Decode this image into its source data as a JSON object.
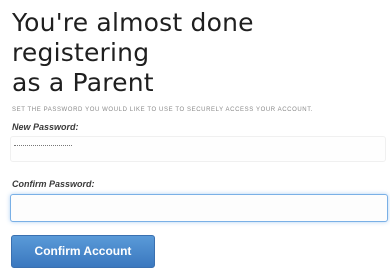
{
  "heading": {
    "line1": "You're almost done registering",
    "line2": "as a Parent",
    "subtitle": "Set the password you would like to use to securely access your account."
  },
  "form": {
    "new_password_label": "New Password:",
    "new_password_value": "••••••••",
    "confirm_password_label": "Confirm Password:",
    "confirm_password_value": "",
    "submit_label": "Confirm Account"
  }
}
